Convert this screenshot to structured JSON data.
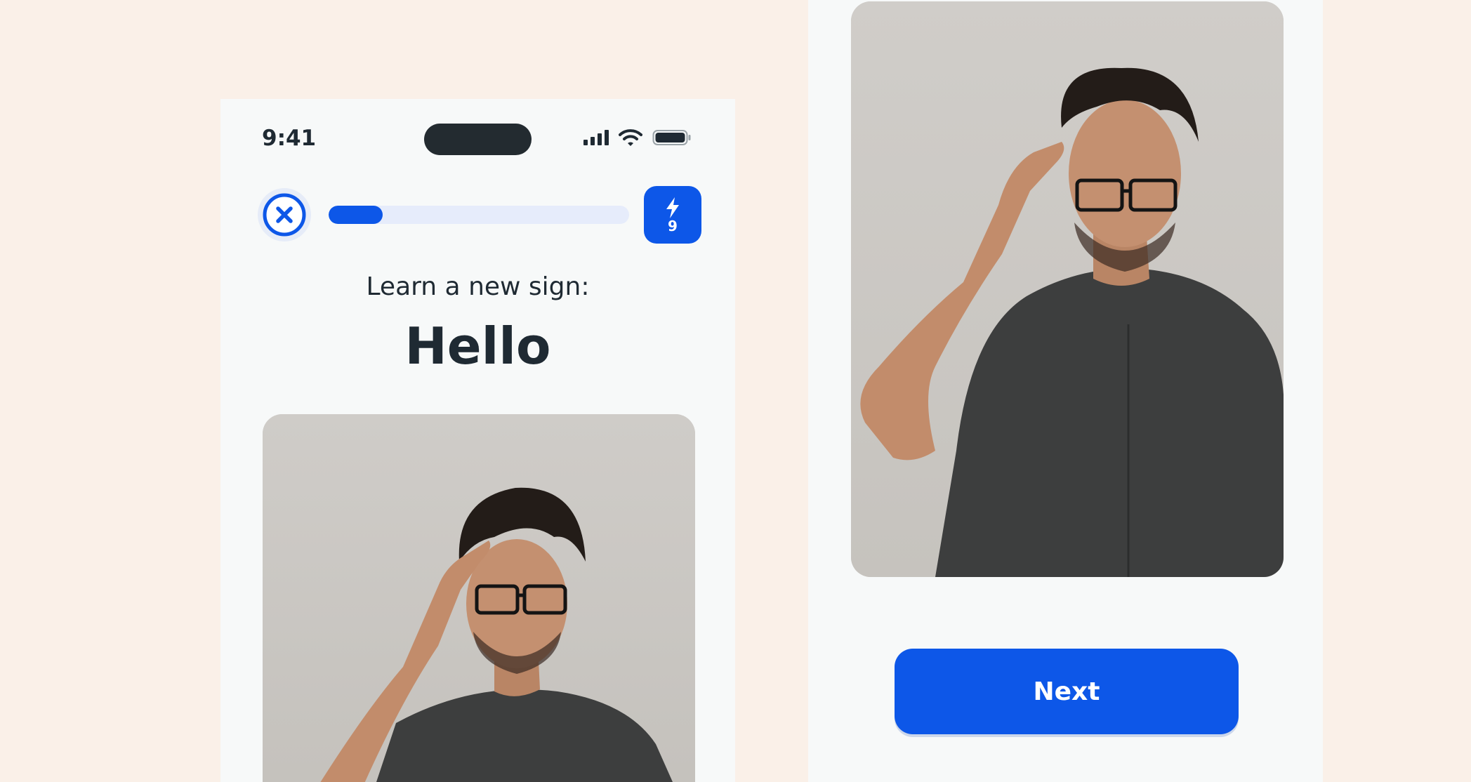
{
  "status_bar": {
    "time": "9:41"
  },
  "lesson": {
    "progress": 0.18,
    "streak_count": "9",
    "prompt": "Learn a new sign:",
    "word": "Hello"
  },
  "actions": {
    "next_label": "Next"
  },
  "colors": {
    "background": "#faf0e8",
    "screen": "#f7f9f9",
    "accent": "#0d57e8",
    "track": "#e6ecfb",
    "text": "#1f2a33"
  },
  "icons": {
    "close": "close-circle-icon",
    "streak": "lightning-bolt-icon",
    "video": "person-signing-hello-video"
  }
}
